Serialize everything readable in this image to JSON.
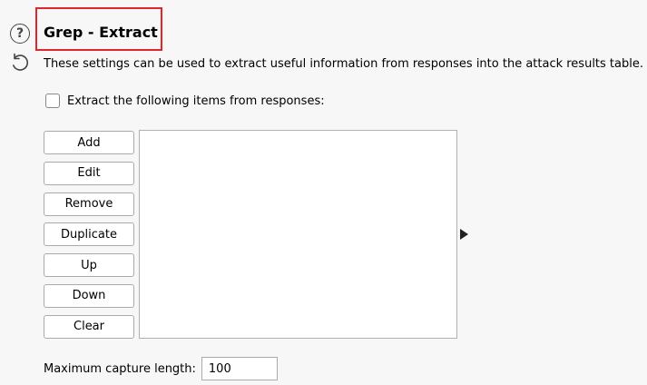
{
  "header": {
    "title": "Grep - Extract",
    "description": "These settings can be used to extract useful information from responses into the attack results table."
  },
  "icons": {
    "help": "help-icon",
    "reset": "reset-icon",
    "help_glyph": "?"
  },
  "extract": {
    "checkbox_label": "Extract the following items from responses:",
    "checked": false
  },
  "buttons": {
    "add": "Add",
    "edit": "Edit",
    "remove": "Remove",
    "duplicate": "Duplicate",
    "up": "Up",
    "down": "Down",
    "clear": "Clear"
  },
  "list": {
    "items": []
  },
  "capture": {
    "label": "Maximum capture length:",
    "value": "100"
  },
  "colors": {
    "highlight_border": "#e1262b",
    "background": "#f7f7f7"
  }
}
